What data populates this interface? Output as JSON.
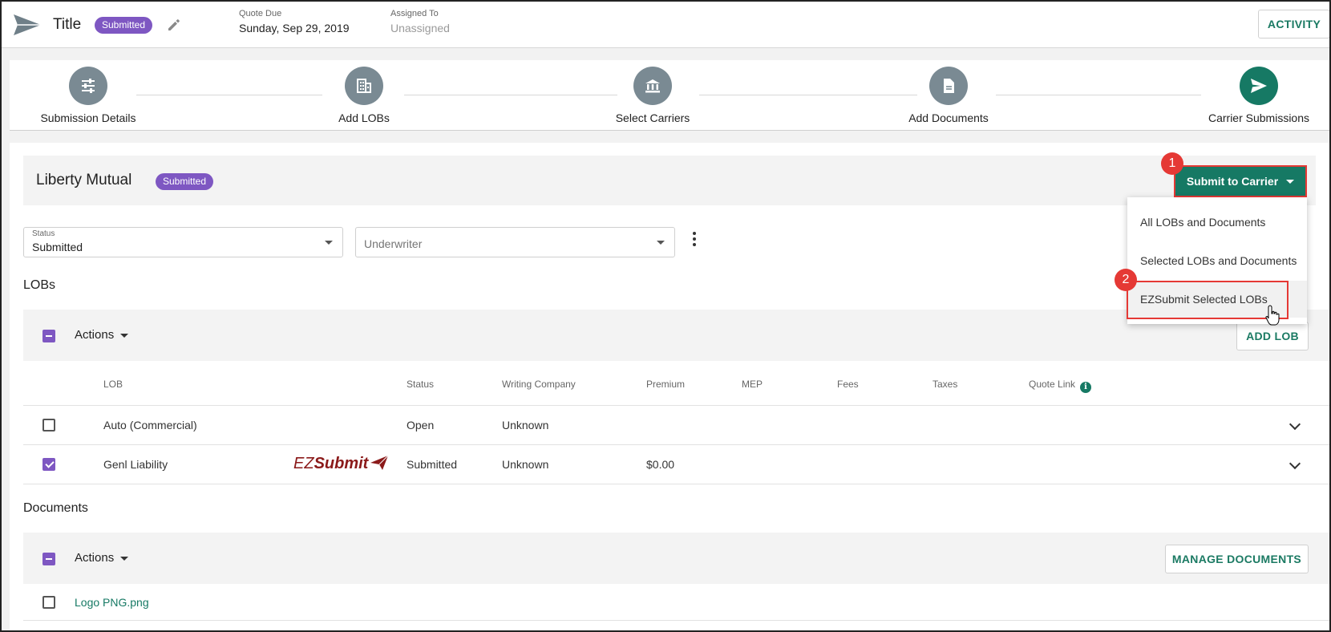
{
  "header": {
    "title": "Title",
    "status_badge": "Submitted",
    "quote_due_label": "Quote Due",
    "quote_due_value": "Sunday, Sep 29, 2019",
    "assigned_to_label": "Assigned To",
    "assigned_to_value": "Unassigned",
    "activity_button": "ACTIVITY"
  },
  "stepper": {
    "steps": [
      {
        "label": "Submission Details",
        "icon": "sliders-icon"
      },
      {
        "label": "Add LOBs",
        "icon": "building-icon"
      },
      {
        "label": "Select Carriers",
        "icon": "bank-icon"
      },
      {
        "label": "Add Documents",
        "icon": "document-icon"
      },
      {
        "label": "Carrier Submissions",
        "icon": "send-icon",
        "active": true
      }
    ]
  },
  "carrier": {
    "name": "Liberty Mutual",
    "status_badge": "Submitted",
    "submit_button": "Submit to Carrier",
    "submit_menu": [
      "All LOBs and Documents",
      "Selected LOBs and Documents",
      "EZSubmit Selected LOBs"
    ],
    "markers": [
      "1",
      "2"
    ]
  },
  "filters": {
    "status_label": "Status",
    "status_value": "Submitted",
    "underwriter_placeholder": "Underwriter"
  },
  "lobs": {
    "section_title": "LOBs",
    "actions_label": "Actions",
    "add_lob_button": "ADD LOB",
    "columns": [
      "LOB",
      "Status",
      "Writing Company",
      "Premium",
      "MEP",
      "Fees",
      "Taxes",
      "Quote Link"
    ],
    "rows": [
      {
        "lob": "Auto (Commercial)",
        "status": "Open",
        "writing_company": "Unknown",
        "premium": "",
        "checked": false,
        "ezsubmit": false
      },
      {
        "lob": "Genl Liability",
        "status": "Submitted",
        "writing_company": "Unknown",
        "premium": "$0.00",
        "checked": true,
        "ezsubmit": true
      }
    ],
    "ezsubmit_text_ez": "EZ",
    "ezsubmit_text_submit": "Submit"
  },
  "documents": {
    "section_title": "Documents",
    "actions_label": "Actions",
    "manage_button": "MANAGE DOCUMENTS",
    "items": [
      "Logo PNG.png"
    ]
  },
  "colors": {
    "primary_green": "#167964",
    "badge_purple": "#7e57c2",
    "highlight_red": "#e53935"
  }
}
